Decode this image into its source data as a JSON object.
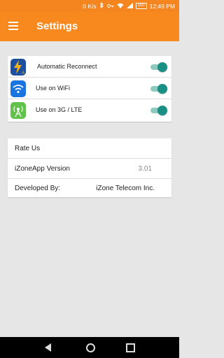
{
  "status_bar": {
    "speed": "0 K/s",
    "battery": "100",
    "time": "12:49 PM"
  },
  "app_bar": {
    "title": "Settings"
  },
  "settings": [
    {
      "label": "Automatic Reconnect",
      "icon": "lightning-icon",
      "icon_color": "#1d4f9e",
      "enabled": true
    },
    {
      "label": "Use on WiFi",
      "icon": "wifi-icon",
      "icon_color": "#1976e0",
      "enabled": true
    },
    {
      "label": "Use on 3G / LTE",
      "icon": "cell-tower-icon",
      "icon_color": "#62c14a",
      "enabled": true
    }
  ],
  "about": {
    "rate_us": "Rate Us",
    "version_label": "iZoneApp Version",
    "version_value": "3.01",
    "developer_label": "Developed By:",
    "developer_value": "iZone Telecom Inc."
  },
  "colors": {
    "accent": "#f7891f",
    "toggle_on": "#1a8f83"
  }
}
